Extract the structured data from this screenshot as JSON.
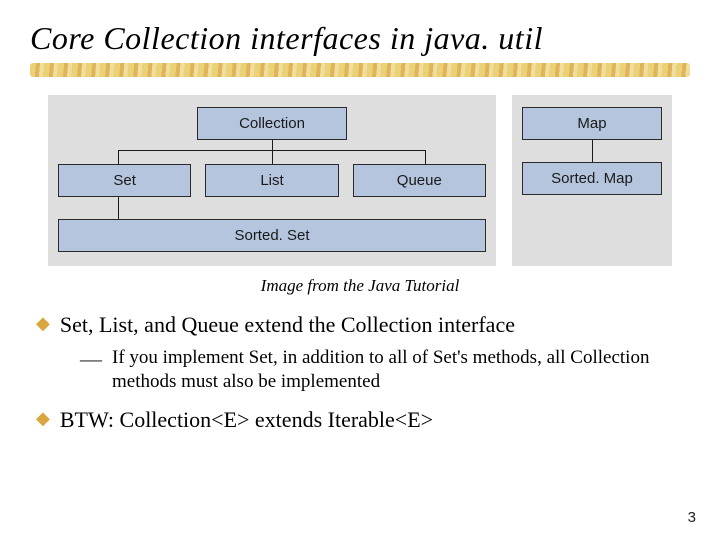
{
  "title": "Core Collection interfaces in java. util",
  "diagram": {
    "left": {
      "root": "Collection",
      "children": [
        "Set",
        "List",
        "Queue"
      ],
      "grandchild": "Sorted. Set"
    },
    "right": {
      "root": "Map",
      "child": "Sorted. Map"
    }
  },
  "caption": "Image from the Java Tutorial",
  "bullets": {
    "b1": "Set, List, and Queue extend the Collection interface",
    "b1_sub": "If you implement Set, in addition to all of Set's methods, all Collection methods must also be implemented",
    "b2": "BTW: Collection<E> extends Iterable<E>"
  },
  "page_number": "3",
  "markers": {
    "diamond": "◆",
    "dash": "—"
  }
}
